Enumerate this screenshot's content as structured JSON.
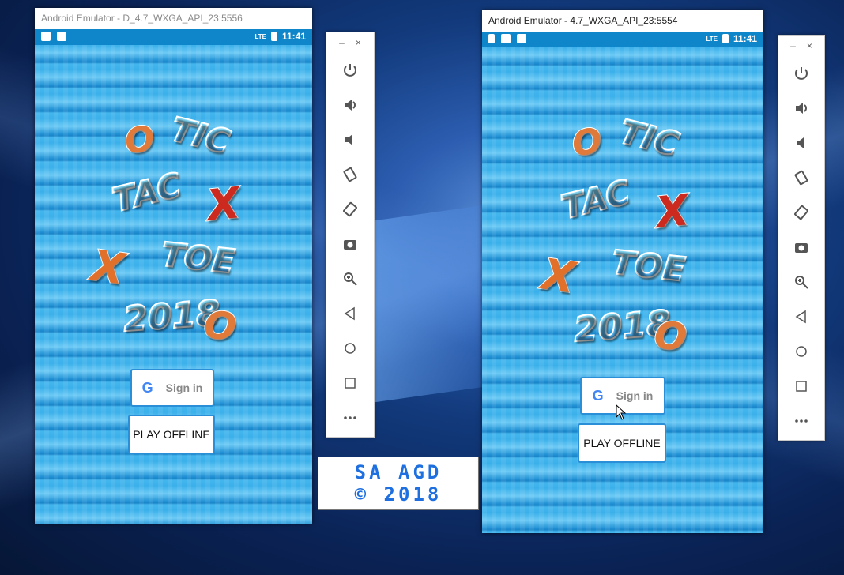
{
  "left_emulator": {
    "title": "Android Emulator - D_4.7_WXGA_API_23:5556",
    "clock": "11:41",
    "signin_label": "Sign in",
    "offline_label": "PLAY OFFLINE"
  },
  "right_emulator": {
    "title": "Android Emulator - 4.7_WXGA_API_23:5554",
    "clock": "11:41",
    "signin_label": "Sign in",
    "offline_label": "PLAY OFFLINE"
  },
  "logo": {
    "o1": "O",
    "tic": "TIC",
    "tac": "TAC",
    "x1": "X",
    "x2": "X",
    "toe": "TOE",
    "year": "2018",
    "o2": "O"
  },
  "toolbar": {
    "minimize": "–",
    "close": "×",
    "buttons": [
      "power-icon",
      "volume-up-icon",
      "volume-down-icon",
      "rotate-left-icon",
      "rotate-right-icon",
      "camera-icon",
      "zoom-icon",
      "back-icon",
      "home-icon",
      "overview-icon",
      "more-icon"
    ]
  },
  "credit": {
    "line1": "SA AGD",
    "line2": "© 2018"
  },
  "status_icons": {
    "network": "LTE"
  },
  "colors": {
    "screen_blue": "#3ab0ea",
    "statusbar": "#0e86c9",
    "credit_blue": "#1e6fe0"
  }
}
